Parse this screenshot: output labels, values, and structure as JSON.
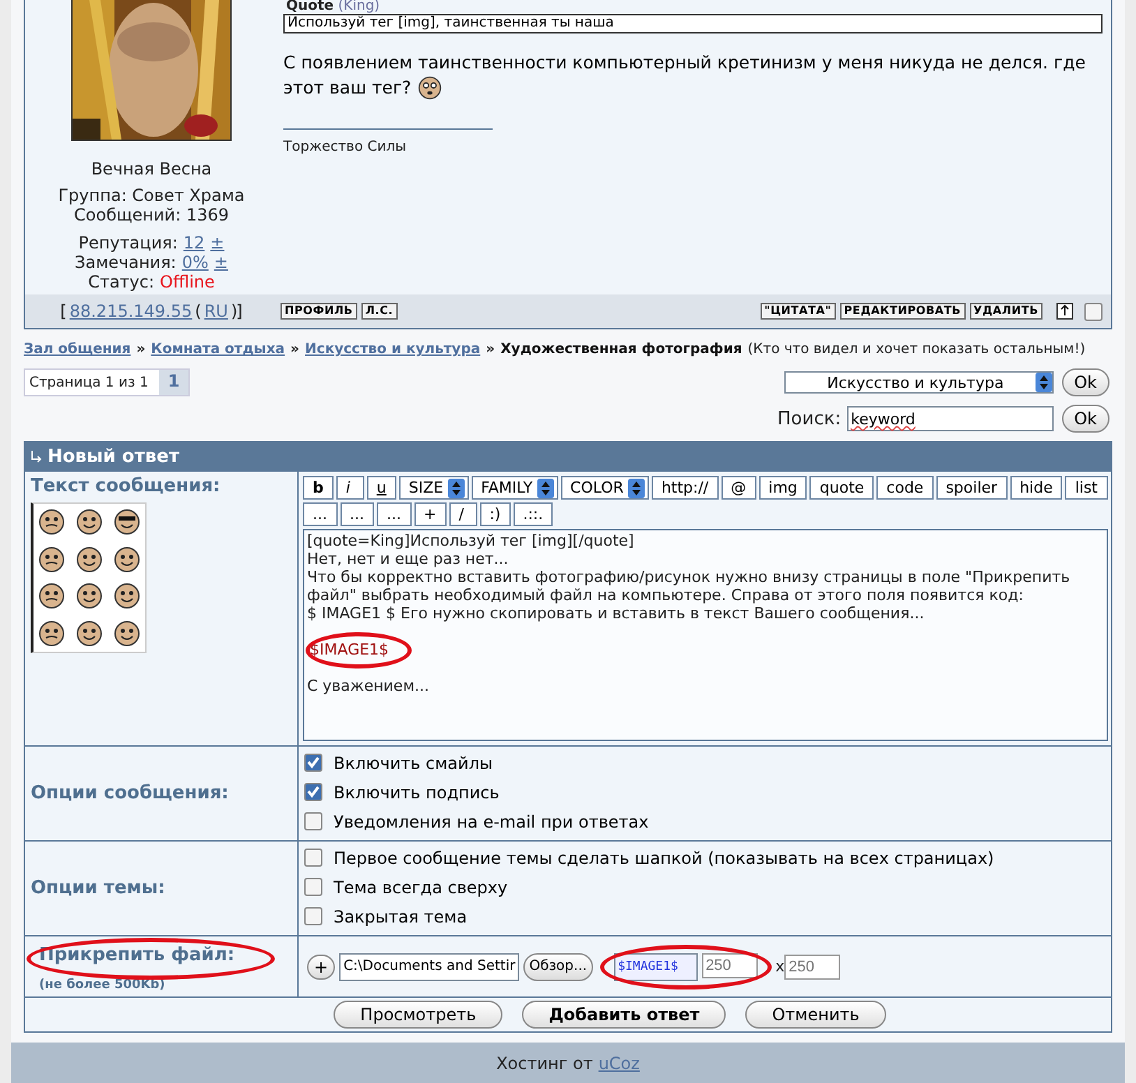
{
  "post": {
    "quote_label": "Quote",
    "quote_author": "(King)",
    "quote_text": "Используй тег [img], таинственная ты наша",
    "message_lines": [
      "С появлением таинственности компьютерный кретинизм у меня никуда не делся. где",
      "этот ваш тег?"
    ],
    "signature": "Торжество Силы",
    "author": {
      "name": "Вечная Весна",
      "group": "Группа: Совет Храма",
      "posts": "Сообщений: 1369",
      "reputation_label": "Репутация:",
      "reputation": "12",
      "reputation_pm": "±",
      "warnings_label": "Замечания:",
      "warnings": "0%",
      "warnings_pm": "±",
      "status_label": "Статус:",
      "status": "Offline"
    },
    "ip_parts": [
      {
        "text": "[",
        "kind": "plain"
      },
      {
        "text": "88.215.149.55",
        "kind": "link"
      },
      {
        "text": "(",
        "kind": "plain"
      },
      {
        "text": "RU",
        "kind": "link"
      },
      {
        "text": ")",
        "kind": "plain"
      },
      {
        "text": "]",
        "kind": "plain"
      }
    ],
    "buttons": [
      "ПРОФИЛЬ",
      "Л.С."
    ],
    "actions": [
      "\"ЦИТАТА\"",
      "РЕДАКТИРОВАТЬ",
      "УДАЛИТЬ"
    ],
    "checked": false
  },
  "breadcrumbs": [
    {
      "text": "Зал общения",
      "kind": "link"
    },
    {
      "text": "»",
      "kind": "sep"
    },
    {
      "text": "Комната отдыха",
      "kind": "link"
    },
    {
      "text": "»",
      "kind": "sep"
    },
    {
      "text": "Искусство и культура",
      "kind": "link"
    },
    {
      "text": "»",
      "kind": "sep"
    },
    {
      "text": "Художественная фотография",
      "kind": "current"
    },
    {
      "text": "(Кто что видел и хочет показать остальным!)",
      "kind": "note"
    }
  ],
  "pagination": {
    "label": "Страница 1 из 1",
    "pages": [
      {
        "label": "1",
        "selected": true
      }
    ]
  },
  "forum_select": {
    "value": "Искусство и культура",
    "button": "Ok"
  },
  "search": {
    "label": "Поиск:",
    "value": "keyword",
    "button": "Ok"
  },
  "reply": {
    "title": "Новый ответ",
    "text_label": "Текст сообщения:",
    "toolbar_rows": [
      [
        {
          "label": "b",
          "kind": "bold"
        },
        {
          "label": "i",
          "kind": "italic"
        },
        {
          "label": "u",
          "kind": "underline"
        },
        {
          "label": "SIZE",
          "kind": "select"
        },
        {
          "label": "FAMILY",
          "kind": "select"
        },
        {
          "label": "COLOR",
          "kind": "select"
        },
        {
          "label": "http://",
          "kind": "button"
        },
        {
          "label": "@",
          "kind": "button"
        },
        {
          "label": "img",
          "kind": "button"
        },
        {
          "label": "quote",
          "kind": "button"
        },
        {
          "label": "code",
          "kind": "button"
        },
        {
          "label": "spoiler",
          "kind": "button"
        },
        {
          "label": "hide",
          "kind": "button"
        },
        {
          "label": "list",
          "kind": "button"
        }
      ],
      [
        {
          "label": "...",
          "kind": "button"
        },
        {
          "label": "...",
          "kind": "button"
        },
        {
          "label": "...",
          "kind": "button"
        },
        {
          "label": "+",
          "kind": "button"
        },
        {
          "label": "/",
          "kind": "button"
        },
        {
          "label": ":)",
          "kind": "button"
        },
        {
          "label": ".::.",
          "kind": "button"
        }
      ]
    ],
    "message_paragraphs": [
      {
        "lines": [
          "[quote=King]Используй тег [img][/quote]",
          "Нет, нет и еще раз нет...",
          "Что бы корректно вставить фотографию/рисунок нужно внизу страницы в поле \"Прикрепить файл\" выбрать необходимый файл на компьютере. Справа от этого поля появится код:",
          "$ IMAGE1 $ Его нужно скопировать и вставить в текст Вашего сообщения..."
        ],
        "kind": "plain"
      },
      {
        "lines": [
          "$IMAGE1$"
        ],
        "kind": "code"
      },
      {
        "lines": [
          "С уважением..."
        ],
        "kind": "plain"
      }
    ],
    "option_groups": [
      {
        "label": "Опции сообщения:",
        "options": [
          {
            "label": "Включить смайлы",
            "checked": true
          },
          {
            "label": "Включить подпись",
            "checked": true
          },
          {
            "label": "Уведомления на e-mail при ответах",
            "checked": false
          }
        ]
      },
      {
        "label": "Опции темы:",
        "options": [
          {
            "label": "Первое сообщение темы сделать шапкой (показывать на всех страницах)",
            "checked": false
          },
          {
            "label": "Тема всегда сверху",
            "checked": false
          },
          {
            "label": "Закрытая тема",
            "checked": false
          }
        ]
      }
    ],
    "attach": {
      "label": "Прикрепить файл:",
      "note": "(не более 500Kb)",
      "add": "+",
      "file": "C:\\Documents and Settir",
      "browse": "Обзор...",
      "code": "$IMAGE1$",
      "width_placeholder": "250",
      "times": "x",
      "height_placeholder": "250"
    },
    "buttons": [
      {
        "label": "Просмотреть",
        "primary": false
      },
      {
        "label": "Добавить ответ",
        "primary": true
      },
      {
        "label": "Отменить",
        "primary": false
      }
    ]
  },
  "footer": {
    "text": "Хостинг от",
    "link": "uCoz"
  }
}
